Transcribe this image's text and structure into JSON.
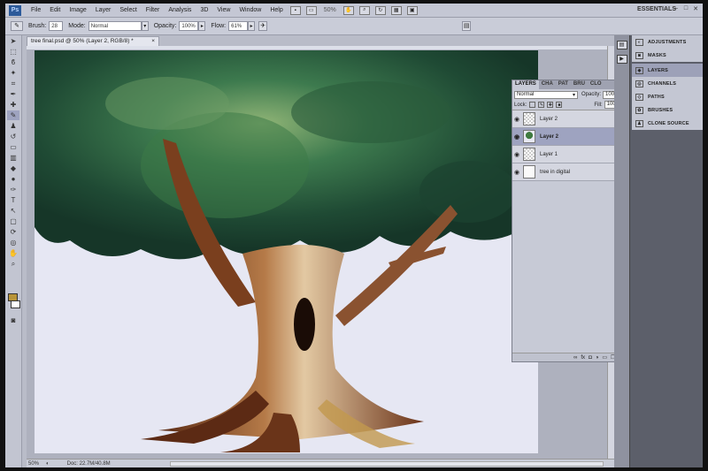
{
  "app": {
    "logo": "Ps",
    "workspace": "ESSENTIALS"
  },
  "menu": [
    "File",
    "Edit",
    "Image",
    "Layer",
    "Select",
    "Filter",
    "Analysis",
    "3D",
    "View",
    "Window",
    "Help"
  ],
  "menubar": {
    "zoom": "50%"
  },
  "options": {
    "brush_label": "Brush:",
    "brush_size": "28",
    "mode_label": "Mode:",
    "mode_value": "Normal",
    "opacity_label": "Opacity:",
    "opacity_value": "100%",
    "flow_label": "Flow:",
    "flow_value": "61%"
  },
  "document": {
    "tab_title": "tree final.psd @ 50% (Layer 2, RGB/8) *",
    "status_zoom": "50%",
    "status_doc": "Doc: 22.7M/40.8M"
  },
  "layers_panel": {
    "tabs": [
      "LAYERS",
      "CHA",
      "PAT",
      "BRU",
      "CLO"
    ],
    "blend_mode": "Normal",
    "opacity_label": "Opacity:",
    "opacity_value": "100%",
    "lock_label": "Lock:",
    "fill_label": "Fill:",
    "fill_value": "100%",
    "layers": [
      {
        "name": "Layer 2",
        "thumb": "transparent",
        "selected": false
      },
      {
        "name": "Layer 2",
        "thumb": "tree",
        "selected": true
      },
      {
        "name": "Layer 1",
        "thumb": "transparent",
        "selected": false
      },
      {
        "name": "tree in digital",
        "thumb": "plain",
        "selected": false
      }
    ],
    "footer_icons": [
      "link-icon",
      "fx-icon",
      "mask-icon",
      "adjustment-icon",
      "folder-icon",
      "new-layer-icon",
      "trash-icon"
    ]
  },
  "dock": {
    "group1": [
      "ADJUSTMENTS",
      "MASKS"
    ],
    "group2": [
      "LAYERS",
      "CHANNELS",
      "PATHS",
      "BRUSHES",
      "CLONE SOURCE"
    ]
  },
  "colors": {
    "foreground": "#b89437",
    "background": "#ffffff",
    "accent": "#2c5a9a"
  }
}
